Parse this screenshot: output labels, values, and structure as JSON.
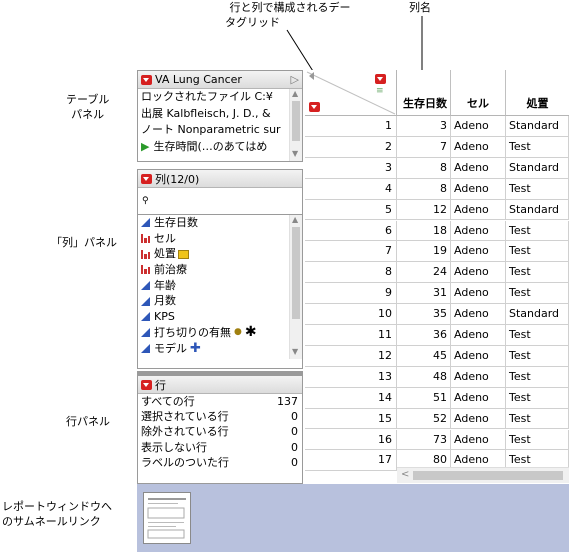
{
  "annotations": {
    "grid_callout_line1": "行と列で構成されるデー",
    "grid_callout_line2": "タグリッド",
    "colnames_callout": "列名",
    "table_panel_line1": "テーブル",
    "table_panel_line2": "パネル",
    "columns_panel": "「列」パネル",
    "rows_panel": "行パネル",
    "thumb_line1": "レポートウィンドウへ",
    "thumb_line2": "のサムネールリンク"
  },
  "table_panel": {
    "title": "VA Lung Cancer",
    "lines": [
      "ロックされたファイル  C:¥",
      "出展  Kalbfleisch, J. D., &",
      "ノート  Nonparametric sur",
      "生存時間(…のあてはめ"
    ]
  },
  "columns_panel": {
    "title": "列(12/0)",
    "search_placeholder": "",
    "items": [
      {
        "label": "生存日数",
        "type": "continuous"
      },
      {
        "label": "セル",
        "type": "nominal"
      },
      {
        "label": "処置",
        "type": "nominal"
      },
      {
        "label": "前治療",
        "type": "nominal"
      },
      {
        "label": "年齢",
        "type": "continuous"
      },
      {
        "label": "月数",
        "type": "continuous"
      },
      {
        "label": "KPS",
        "type": "continuous"
      },
      {
        "label": "打ち切りの有無",
        "type": "continuous"
      },
      {
        "label": "モデル",
        "type": "continuous"
      }
    ]
  },
  "rows_panel": {
    "title": "行",
    "items": [
      {
        "label": "すべての行",
        "value": "137"
      },
      {
        "label": "選択されている行",
        "value": "0"
      },
      {
        "label": "除外されている行",
        "value": "0"
      },
      {
        "label": "表示しない行",
        "value": "0"
      },
      {
        "label": "ラベルのついた行",
        "value": "0"
      }
    ]
  },
  "grid": {
    "columns": [
      "生存日数",
      "セル",
      "処置"
    ],
    "rows": [
      [
        "1",
        "3",
        "Adeno",
        "Standard"
      ],
      [
        "2",
        "7",
        "Adeno",
        "Test"
      ],
      [
        "3",
        "8",
        "Adeno",
        "Standard"
      ],
      [
        "4",
        "8",
        "Adeno",
        "Test"
      ],
      [
        "5",
        "12",
        "Adeno",
        "Standard"
      ],
      [
        "6",
        "18",
        "Adeno",
        "Test"
      ],
      [
        "7",
        "19",
        "Adeno",
        "Test"
      ],
      [
        "8",
        "24",
        "Adeno",
        "Test"
      ],
      [
        "9",
        "31",
        "Adeno",
        "Test"
      ],
      [
        "10",
        "35",
        "Adeno",
        "Standard"
      ],
      [
        "11",
        "36",
        "Adeno",
        "Test"
      ],
      [
        "12",
        "45",
        "Adeno",
        "Test"
      ],
      [
        "13",
        "48",
        "Adeno",
        "Test"
      ],
      [
        "14",
        "51",
        "Adeno",
        "Test"
      ],
      [
        "15",
        "52",
        "Adeno",
        "Test"
      ],
      [
        "16",
        "73",
        "Adeno",
        "Test"
      ],
      [
        "17",
        "80",
        "Adeno",
        "Test"
      ]
    ]
  },
  "colors": {
    "red_triangle": "#d62020",
    "continuous_icon": "#2e57b8",
    "nominal_icon": "#cc2f2f",
    "bottom_band": "#b8c1dd"
  }
}
